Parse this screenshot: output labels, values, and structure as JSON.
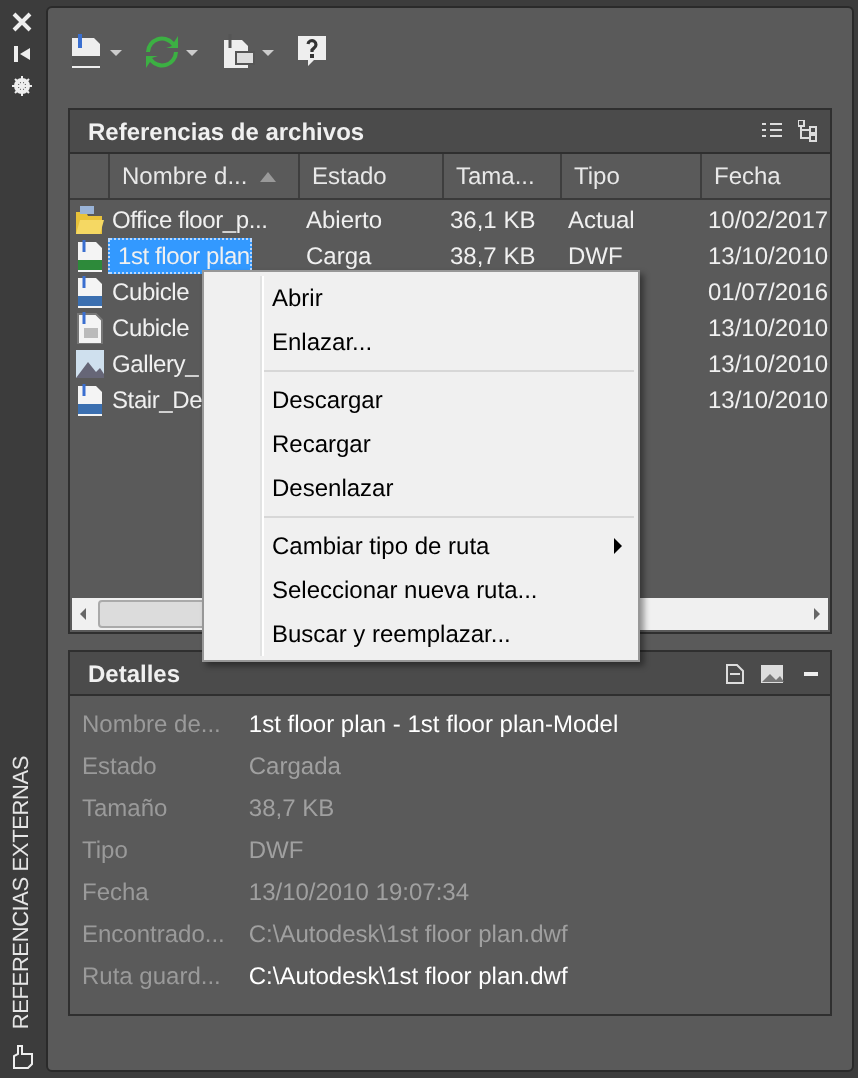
{
  "side_strip": {
    "title": "REFERENCIAS EXTERNAS"
  },
  "file_references": {
    "title": "Referencias de archivos",
    "columns": [
      {
        "label": "Nombre d...",
        "sorted": true
      },
      {
        "label": "Estado",
        "sorted": false
      },
      {
        "label": "Tama...",
        "sorted": false
      },
      {
        "label": "Tipo",
        "sorted": false
      },
      {
        "label": "Fecha",
        "sorted": false
      }
    ],
    "rows": [
      {
        "kind": "dwg-open",
        "name": "Office floor_p...",
        "status": "Abierto",
        "size": "36,1 KB",
        "type": "Actual",
        "date": "10/02/2017",
        "selected": false
      },
      {
        "kind": "dwf",
        "name": "1st floor plan",
        "status": "Carga",
        "size": "38,7 KB",
        "type": "DWF",
        "date": "13/10/2010",
        "selected": true
      },
      {
        "kind": "dwg",
        "name": "Cubicle",
        "date": "01/07/2016",
        "selected": false
      },
      {
        "kind": "pdf",
        "name": "Cubicle",
        "date": "13/10/2010",
        "selected": false
      },
      {
        "kind": "image",
        "name": "Gallery_",
        "date": "13/10/2010",
        "selected": false
      },
      {
        "kind": "dgn",
        "name": "Stair_De",
        "date": "13/10/2010",
        "selected": false
      }
    ]
  },
  "context_menu": [
    {
      "kind": "item",
      "label": "Abrir",
      "submenu": false
    },
    {
      "kind": "item",
      "label": "Enlazar...",
      "submenu": false
    },
    {
      "kind": "separator"
    },
    {
      "kind": "item",
      "label": "Descargar",
      "submenu": false
    },
    {
      "kind": "item",
      "label": "Recargar",
      "submenu": false
    },
    {
      "kind": "item",
      "label": "Desenlazar",
      "submenu": false
    },
    {
      "kind": "separator"
    },
    {
      "kind": "item",
      "label": "Cambiar tipo de ruta",
      "submenu": true
    },
    {
      "kind": "item",
      "label": "Seleccionar nueva ruta...",
      "submenu": false
    },
    {
      "kind": "item",
      "label": "Buscar y reemplazar...",
      "submenu": false
    }
  ],
  "details": {
    "title": "Detalles",
    "fields": [
      {
        "label": "Nombre de...",
        "value": "1st floor plan - 1st floor plan-Model",
        "editable": true
      },
      {
        "label": "Estado",
        "value": "Cargada",
        "editable": false
      },
      {
        "label": "Tamaño",
        "value": "38,7 KB",
        "editable": false
      },
      {
        "label": "Tipo",
        "value": "DWF",
        "editable": false
      },
      {
        "label": "Fecha",
        "value": "13/10/2010 19:07:34",
        "editable": false
      },
      {
        "label": "Encontrado...",
        "value": "C:\\Autodesk\\1st floor plan.dwf",
        "editable": false
      },
      {
        "label": "Ruta guard...",
        "value": "C:\\Autodesk\\1st floor plan.dwf",
        "editable": true
      }
    ]
  }
}
